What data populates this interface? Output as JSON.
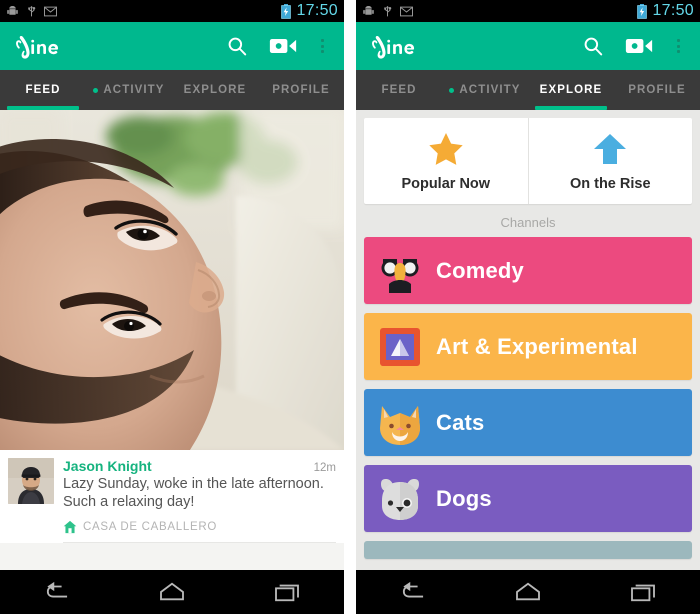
{
  "app": {
    "name": "Vine",
    "accent_green": "#00b88e",
    "tab_bar_bg": "#3a3a3a",
    "active_tab_color": "#ffffff"
  },
  "status_bar": {
    "time": "17:50",
    "time_color": "#63d7e8",
    "icons": [
      "android-debug-icon",
      "usb-icon",
      "gmail-icon",
      "battery-charging-icon"
    ]
  },
  "action_bar": {
    "logo_text": "Vine",
    "actions": [
      {
        "name": "search-icon",
        "label": "Search"
      },
      {
        "name": "record-video-icon",
        "label": "Record"
      },
      {
        "name": "overflow-menu-icon",
        "label": "More options"
      }
    ]
  },
  "tabs": [
    {
      "label": "FEED",
      "has_dot": false
    },
    {
      "label": "ACTIVITY",
      "has_dot": true
    },
    {
      "label": "EXPLORE",
      "has_dot": false
    },
    {
      "label": "PROFILE",
      "has_dot": false
    }
  ],
  "left_screen": {
    "active_tab": "FEED",
    "post": {
      "author": "Jason Knight",
      "timestamp": "12m",
      "caption": "Lazy Sunday, woke in the late afternoon. Such a relaxing day!",
      "location": "CASA DE CABALLERO",
      "location_icon": "home-icon",
      "media_alt": "woman-lying-on-bed-closeup"
    }
  },
  "right_screen": {
    "active_tab": "EXPLORE",
    "quick_links": [
      {
        "label": "Popular Now",
        "icon": "star-icon",
        "color": "#f5ab35"
      },
      {
        "label": "On the Rise",
        "icon": "up-arrow-icon",
        "color": "#4aaee0"
      }
    ],
    "section_label": "Channels",
    "channels": [
      {
        "label": "Comedy",
        "color": "#ec4a7f",
        "icon": "disguise-glasses-icon"
      },
      {
        "label": "Art & Experimental",
        "color": "#fbb54a",
        "icon": "framed-painting-icon"
      },
      {
        "label": "Cats",
        "color": "#3d8cd0",
        "icon": "cat-face-icon"
      },
      {
        "label": "Dogs",
        "color": "#7a5cc0",
        "icon": "dog-face-icon"
      },
      {
        "label": "",
        "color": "#9cb8bd",
        "icon": ""
      }
    ]
  },
  "nav_bar": {
    "buttons": [
      {
        "name": "back-button",
        "label": "Back"
      },
      {
        "name": "home-button",
        "label": "Home"
      },
      {
        "name": "recents-button",
        "label": "Recent apps"
      }
    ]
  }
}
